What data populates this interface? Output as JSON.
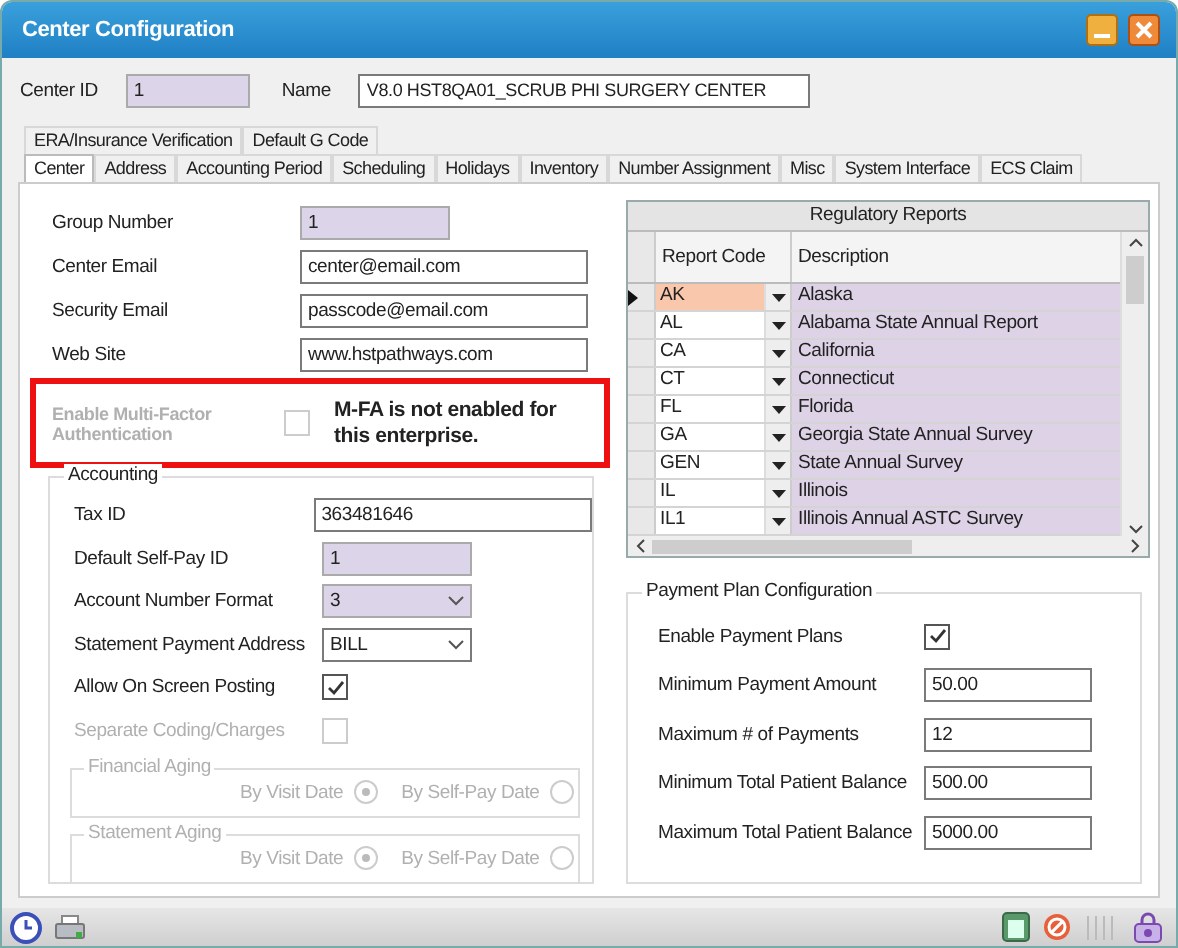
{
  "window": {
    "title": "Center Configuration"
  },
  "header": [
    {
      "label": "Center ID",
      "value": "1",
      "readonly": true,
      "kind": "short"
    },
    {
      "label": "Name",
      "value": "V8.0 HST8QA01_SCRUB PHI SURGERY CENTER",
      "readonly": false,
      "kind": "long"
    }
  ],
  "tab_rows": [
    [
      {
        "label": "ERA/Insurance Verification",
        "selected": false
      },
      {
        "label": "Default G Code",
        "selected": false
      }
    ],
    [
      {
        "label": "Center",
        "selected": true
      },
      {
        "label": "Address",
        "selected": false
      },
      {
        "label": "Accounting Period",
        "selected": false
      },
      {
        "label": "Scheduling",
        "selected": false
      },
      {
        "label": "Holidays",
        "selected": false
      },
      {
        "label": "Inventory",
        "selected": false
      },
      {
        "label": "Number Assignment",
        "selected": false
      },
      {
        "label": "Misc",
        "selected": false
      },
      {
        "label": "System Interface",
        "selected": false
      },
      {
        "label": "ECS Claim",
        "selected": false
      }
    ]
  ],
  "center_fields": [
    {
      "label": "Group Number",
      "kind": "text",
      "value": "1",
      "readonly": true
    },
    {
      "label": "Center Email",
      "kind": "text",
      "value": "center@email.com",
      "readonly": false
    },
    {
      "label": "Security Email",
      "kind": "text",
      "value": "passcode@email.com",
      "readonly": false
    },
    {
      "label": "Web Site",
      "kind": "text",
      "value": "www.hstpathways.com",
      "readonly": false
    }
  ],
  "mfa": {
    "label": "Enable Multi-Factor Authentication",
    "checked": false,
    "disabled": true,
    "note": "M-FA is not enabled for this enterprise."
  },
  "accounting": {
    "title": "Accounting",
    "fields": [
      {
        "label": "Tax ID",
        "kind": "text",
        "value": "363481646",
        "readonly": false
      },
      {
        "label": "Default Self-Pay ID",
        "kind": "text",
        "value": "1",
        "readonly": true
      },
      {
        "label": "Account Number Format",
        "kind": "select",
        "value": "3",
        "readonly": true
      },
      {
        "label": "Statement Payment Address",
        "kind": "select",
        "value": "BILL",
        "readonly": false
      },
      {
        "label": "Allow On Screen Posting",
        "kind": "checkbox",
        "checked": true,
        "disabled": false
      },
      {
        "label": "Separate Coding/Charges",
        "kind": "checkbox",
        "checked": false,
        "disabled": true
      }
    ],
    "agings": [
      {
        "title": "Financial Aging",
        "disabled": true,
        "options": [
          {
            "label": "By Visit Date",
            "selected": true
          },
          {
            "label": "By Self-Pay Date",
            "selected": false
          }
        ]
      },
      {
        "title": "Statement Aging",
        "disabled": true,
        "options": [
          {
            "label": "By Visit Date",
            "selected": true
          },
          {
            "label": "By Self-Pay Date",
            "selected": false
          }
        ]
      }
    ]
  },
  "regulatory_reports": {
    "title": "Regulatory Reports",
    "columns": [
      "Report Code",
      "Description"
    ],
    "rows": [
      {
        "code": "AK",
        "description": "Alaska",
        "selected": true
      },
      {
        "code": "AL",
        "description": "Alabama State Annual Report",
        "selected": false
      },
      {
        "code": "CA",
        "description": "California",
        "selected": false
      },
      {
        "code": "CT",
        "description": "Connecticut",
        "selected": false
      },
      {
        "code": "FL",
        "description": "Florida",
        "selected": false
      },
      {
        "code": "GA",
        "description": "Georgia State Annual Survey",
        "selected": false
      },
      {
        "code": "GEN",
        "description": "State Annual Survey",
        "selected": false
      },
      {
        "code": "IL",
        "description": "Illinois",
        "selected": false
      },
      {
        "code": "IL1",
        "description": "Illinois Annual ASTC Survey",
        "selected": false
      }
    ]
  },
  "payment_plan": {
    "title": "Payment Plan Configuration",
    "fields": [
      {
        "label": "Enable Payment Plans",
        "kind": "checkbox",
        "checked": true,
        "disabled": false
      },
      {
        "label": "Minimum Payment Amount",
        "kind": "text",
        "value": "50.00",
        "readonly": false
      },
      {
        "label": "Maximum # of Payments",
        "kind": "text",
        "value": "12",
        "readonly": false
      },
      {
        "label": "Minimum Total Patient Balance",
        "kind": "text",
        "value": "500.00",
        "readonly": false
      },
      {
        "label": "Maximum Total Patient Balance",
        "kind": "text",
        "value": "5000.00",
        "readonly": false
      }
    ]
  }
}
